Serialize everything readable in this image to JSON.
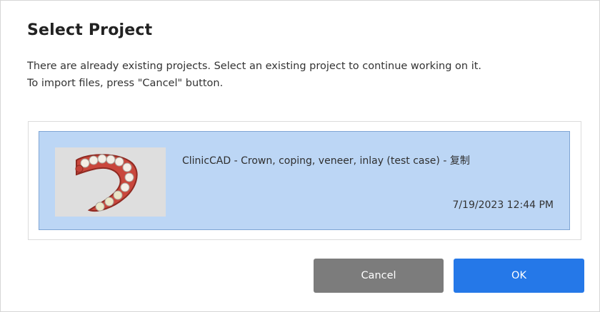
{
  "dialog": {
    "title": "Select Project",
    "description_line1": "There are already existing projects. Select an existing project to continue working on it.",
    "description_line2": "To import files, press \"Cancel\" button."
  },
  "projects": [
    {
      "name": "ClinicCAD - Crown, coping, veneer, inlay (test case) - 复制",
      "date": "7/19/2023 12:44 PM",
      "selected": true,
      "thumbnail_icon": "dental-arch-icon"
    }
  ],
  "buttons": {
    "cancel_label": "Cancel",
    "ok_label": "OK"
  },
  "colors": {
    "selection_bg": "#bcd6f5",
    "cancel_bg": "#7c7c7c",
    "ok_bg": "#2578e8"
  }
}
